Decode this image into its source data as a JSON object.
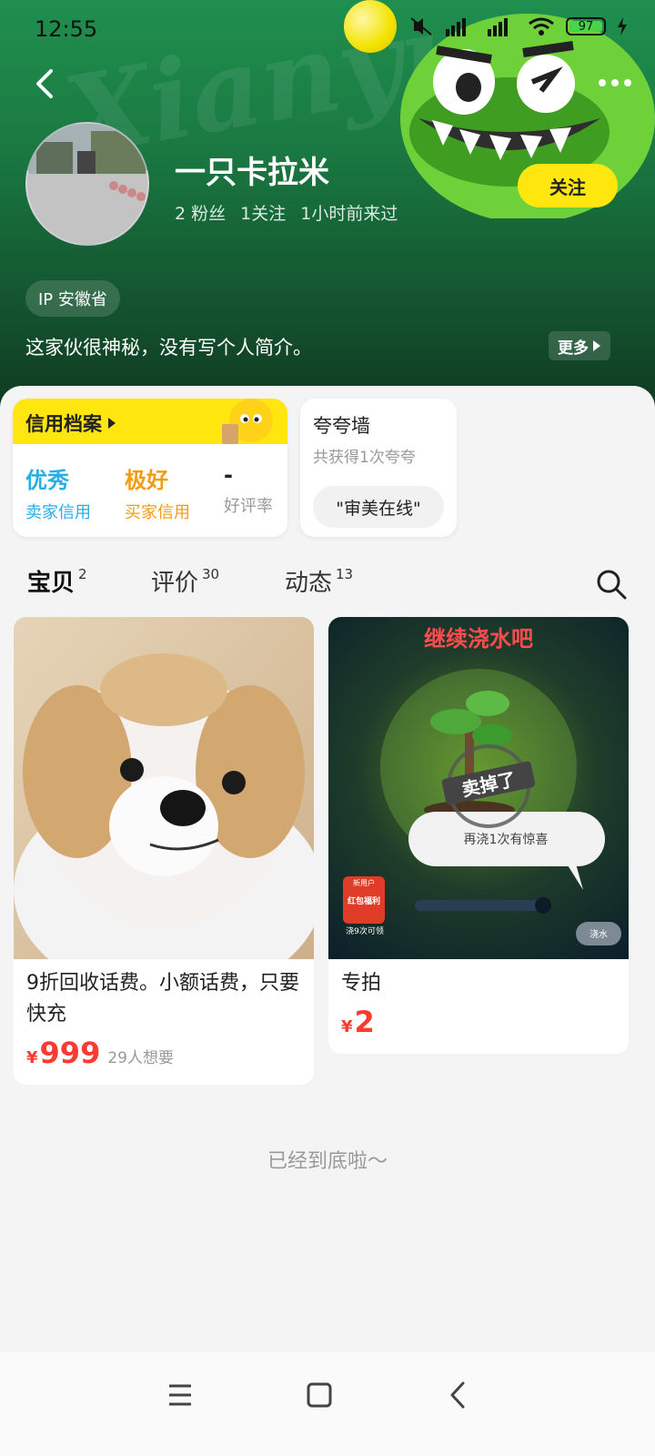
{
  "status_bar": {
    "time": "12:55",
    "battery": "97"
  },
  "header": {
    "watermark": "Xianyu",
    "username": "一只卡拉米",
    "stats": [
      "2 粉丝",
      "1关注",
      "1小时前来过"
    ],
    "follow_label": "关注",
    "ip": "IP 安徽省",
    "bio": "这家伙很神秘，没有写个人简介。",
    "more_label": "更多"
  },
  "credit": {
    "title": "信用档案",
    "items": [
      {
        "value": "优秀",
        "label": "卖家信用",
        "color": "#27aee6"
      },
      {
        "value": "极好",
        "label": "买家信用",
        "color": "#f39c12"
      },
      {
        "value": "-",
        "label": "好评率",
        "color": "#222222"
      }
    ]
  },
  "praise": {
    "title": "夸夸墙",
    "subtitle": "共获得1次夸夸",
    "chip": "\"审美在线\""
  },
  "tabs": [
    {
      "label": "宝贝",
      "count": "2"
    },
    {
      "label": "评价",
      "count": "30"
    },
    {
      "label": "动态",
      "count": "13"
    }
  ],
  "products": [
    {
      "title": "9折回收话费。小额话费，只要快充",
      "price": "999",
      "yen": "¥",
      "wants": "29人想要"
    },
    {
      "title": "专拍",
      "price": "2",
      "yen": "¥",
      "image_texts": {
        "banner": "继续浇水吧",
        "sold": "卖掉了",
        "bubble": "再浇1次有惊喜",
        "badge_top": "新用户",
        "badge_main": "红包福利",
        "badge_bottom": "浇9次可领",
        "water": "浇水"
      }
    }
  ],
  "end_text": "已经到底啦～",
  "colors": {
    "accent": "#ffe60f",
    "price": "#ff3a30",
    "hero": "#1a7a42"
  }
}
